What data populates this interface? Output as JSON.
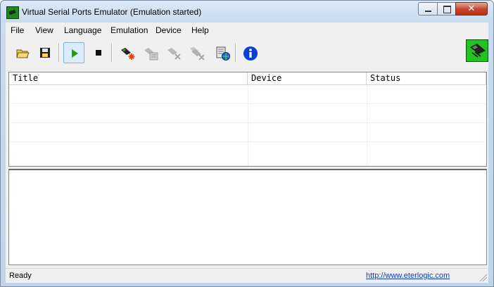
{
  "window": {
    "title": "Virtual Serial Ports Emulator (Emulation started)",
    "close_glyph": "✕"
  },
  "menu": [
    "File",
    "View",
    "Language",
    "Emulation",
    "Device",
    "Help"
  ],
  "toolbar": {
    "buttons": [
      {
        "icon": "open-folder-icon",
        "enabled": true
      },
      {
        "icon": "save-disk-icon",
        "enabled": true
      },
      {
        "icon": "play-icon",
        "enabled": true,
        "pressed": true
      },
      {
        "icon": "stop-icon",
        "enabled": true
      },
      {
        "icon": "create-device-icon",
        "enabled": true
      },
      {
        "icon": "device-properties-icon",
        "enabled": false
      },
      {
        "icon": "delete-device-icon",
        "enabled": false
      },
      {
        "icon": "delete-all-devices-icon",
        "enabled": false
      },
      {
        "icon": "network-settings-icon",
        "enabled": true
      },
      {
        "icon": "info-icon",
        "enabled": true
      }
    ]
  },
  "device_list": {
    "columns": [
      "Title",
      "Device",
      "Status"
    ],
    "rows": []
  },
  "statusbar": {
    "status": "Ready",
    "link": "http://www.eterlogic.com"
  },
  "colors": {
    "accent_green": "#22c422",
    "link_blue": "#0b3fbf",
    "info_blue": "#0a3fd8",
    "close_red": "#c7432b"
  }
}
